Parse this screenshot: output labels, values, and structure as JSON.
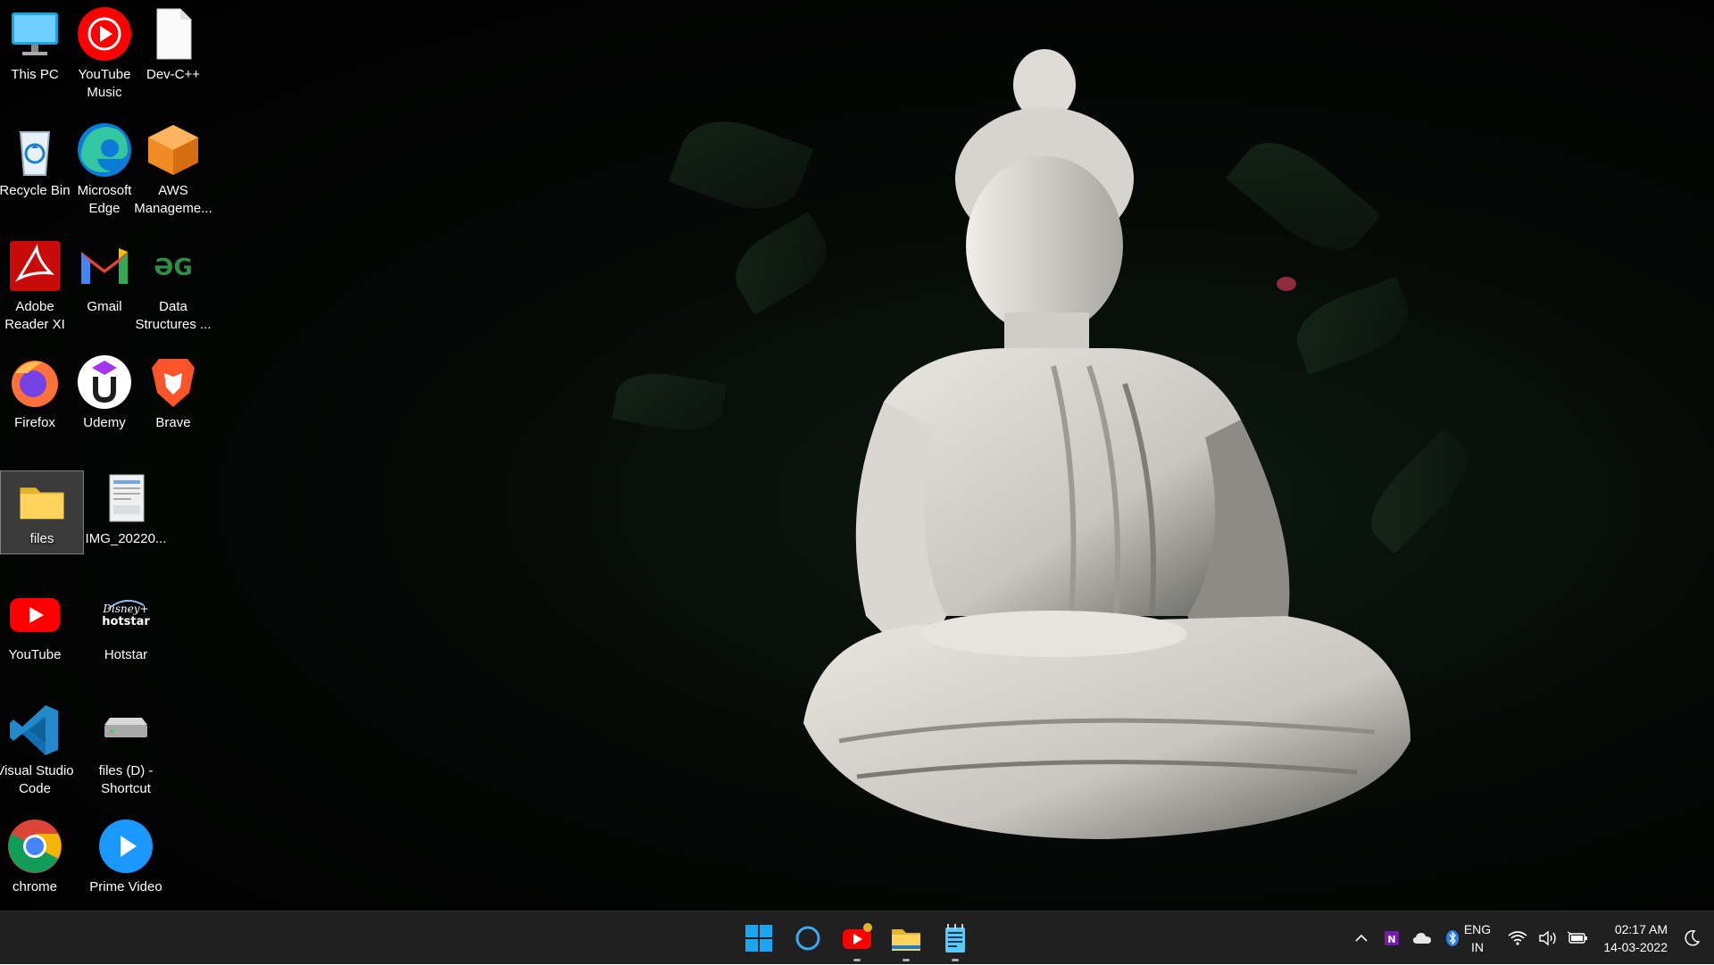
{
  "desktop_icons": [
    {
      "label": "This PC",
      "icon": "monitor-icon"
    },
    {
      "label": "YouTube Music",
      "icon": "youtube-music-icon"
    },
    {
      "label": "Dev-C++",
      "icon": "blank-file-icon"
    },
    {
      "label": "Recycle Bin",
      "icon": "recycle-bin-icon"
    },
    {
      "label": "Microsoft Edge",
      "icon": "edge-icon"
    },
    {
      "label": "AWS Manageme...",
      "icon": "aws-cube-icon"
    },
    {
      "label": "Adobe Reader XI",
      "icon": "adobe-reader-icon"
    },
    {
      "label": "Gmail",
      "icon": "gmail-icon"
    },
    {
      "label": "Data Structures ...",
      "icon": "gfg-icon"
    },
    {
      "label": "Firefox",
      "icon": "firefox-icon"
    },
    {
      "label": "Udemy",
      "icon": "udemy-icon"
    },
    {
      "label": "Brave",
      "icon": "brave-icon"
    },
    {
      "label": "files",
      "icon": "folder-icon"
    },
    {
      "label": "IMG_20220...",
      "icon": "image-file-icon"
    },
    {
      "label": "YouTube",
      "icon": "youtube-icon"
    },
    {
      "label": "Hotstar",
      "icon": "hotstar-icon"
    },
    {
      "label": "Visual Studio Code",
      "icon": "vscode-icon"
    },
    {
      "label": "files (D) - Shortcut",
      "icon": "drive-shortcut-icon"
    },
    {
      "label": "chrome",
      "icon": "chrome-icon"
    },
    {
      "label": "Prime Video",
      "icon": "prime-video-icon"
    }
  ],
  "taskbar": {
    "apps": [
      "start-icon",
      "cortana-icon",
      "youtube-icon",
      "file-explorer-icon",
      "notepad-icon"
    ],
    "language": {
      "line1": "ENG",
      "line2": "IN"
    },
    "time": "02:17 AM",
    "date": "14-03-2022",
    "tray_icons": [
      "chevron-up-icon",
      "onenote-icon",
      "onedrive-icon",
      "bluetooth-icon",
      "wifi-icon",
      "volume-icon",
      "battery-icon",
      "focus-assist-icon"
    ]
  }
}
